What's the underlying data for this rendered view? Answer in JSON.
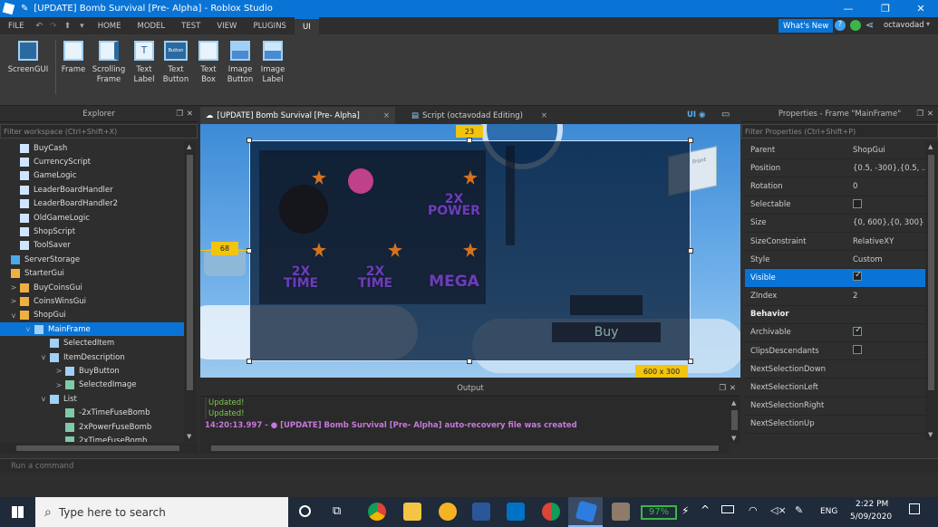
{
  "window": {
    "title": "[UPDATE] Bomb Survival [Pre- Alpha] - Roblox Studio",
    "whats_new": "What's New",
    "user": "octavodad"
  },
  "menu": [
    "FILE",
    "HOME",
    "MODEL",
    "TEST",
    "VIEW",
    "PLUGINS",
    "UI"
  ],
  "ribbon": [
    {
      "l1": "ScreenGUI",
      "l2": ""
    },
    {
      "l1": "Frame",
      "l2": ""
    },
    {
      "l1": "Scrolling",
      "l2": "Frame"
    },
    {
      "l1": "Text",
      "l2": "Label"
    },
    {
      "l1": "Text",
      "l2": "Button"
    },
    {
      "l1": "Text",
      "l2": "Box"
    },
    {
      "l1": "Image",
      "l2": "Button"
    },
    {
      "l1": "Image",
      "l2": "Label"
    }
  ],
  "ribbon_textbutton_glyph": "Button",
  "ribbon_text_glyph": "T",
  "explorer": {
    "title": "Explorer",
    "filter": "Filter workspace (Ctrl+Shift+X)",
    "items": [
      {
        "label": "BuyCash",
        "expander": ""
      },
      {
        "label": "CurrencyScript",
        "expander": ""
      },
      {
        "label": "GameLogic",
        "expander": ""
      },
      {
        "label": "LeaderBoardHandler",
        "expander": ""
      },
      {
        "label": "LeaderBoardHandler2",
        "expander": ""
      },
      {
        "label": "OldGameLogic",
        "expander": ""
      },
      {
        "label": "ShopScript",
        "expander": ""
      },
      {
        "label": "ToolSaver",
        "expander": ""
      },
      {
        "label": "ServerStorage",
        "expander": ""
      },
      {
        "label": "StarterGui",
        "expander": ""
      },
      {
        "label": "BuyCoinsGui",
        "expander": ">"
      },
      {
        "label": "CoinsWinsGui",
        "expander": ">"
      },
      {
        "label": "ShopGui",
        "expander": "v"
      },
      {
        "label": "MainFrame",
        "expander": "v"
      },
      {
        "label": "SelectedItem",
        "expander": ""
      },
      {
        "label": "ItemDescription",
        "expander": "v"
      },
      {
        "label": "BuyButton",
        "expander": ">"
      },
      {
        "label": "SelectedImage",
        "expander": ">"
      },
      {
        "label": "List",
        "expander": "v"
      },
      {
        "label": "-2xTimeFuseBomb",
        "expander": ""
      },
      {
        "label": "2xPowerFuseBomb",
        "expander": ""
      },
      {
        "label": "2xTimeFuseBomb",
        "expander": ""
      }
    ]
  },
  "tabs": [
    {
      "label": "[UPDATE] Bomb Survival [Pre- Alpha]",
      "close": "×"
    },
    {
      "label": "Script (octavodad Editing)",
      "close": "×"
    }
  ],
  "tab_ui_label": "UI",
  "viewport": {
    "top_offset": "23",
    "left_offset": "68",
    "size_label": "600 x 300",
    "cells": [
      "2X POWER",
      "2X TIME",
      "2X TIME",
      "MEGA"
    ],
    "buy": "Buy",
    "cube_label": "Front"
  },
  "output": {
    "title": "Output",
    "lines": [
      "Updated!",
      "Updated!"
    ],
    "timestamp": "14:20:13.997 -",
    "message": "[UPDATE] Bomb Survival [Pre- Alpha] auto-recovery file was created"
  },
  "properties": {
    "title": "Properties - Frame \"MainFrame\"",
    "filter": "Filter Properties (Ctrl+Shift+P)",
    "rows": [
      {
        "name": "Parent",
        "value": "ShopGui",
        "type": "text"
      },
      {
        "name": "Position",
        "value": "{0.5, -300},{0.5, ...",
        "type": "text"
      },
      {
        "name": "Rotation",
        "value": "0",
        "type": "text"
      },
      {
        "name": "Selectable",
        "value": "",
        "type": "check-off"
      },
      {
        "name": "Size",
        "value": "{0, 600},{0, 300}",
        "type": "text"
      },
      {
        "name": "SizeConstraint",
        "value": "RelativeXY",
        "type": "text"
      },
      {
        "name": "Style",
        "value": "Custom",
        "type": "text"
      },
      {
        "name": "Visible",
        "value": "",
        "type": "check-on"
      },
      {
        "name": "ZIndex",
        "value": "2",
        "type": "text"
      },
      {
        "name": "Behavior",
        "value": "",
        "type": "section"
      },
      {
        "name": "Archivable",
        "value": "",
        "type": "check-on"
      },
      {
        "name": "ClipsDescendants",
        "value": "",
        "type": "check-off"
      },
      {
        "name": "NextSelectionDown",
        "value": "",
        "type": "text"
      },
      {
        "name": "NextSelectionLeft",
        "value": "",
        "type": "text"
      },
      {
        "name": "NextSelectionRight",
        "value": "",
        "type": "text"
      },
      {
        "name": "NextSelectionUp",
        "value": "",
        "type": "text"
      }
    ]
  },
  "command": {
    "placeholder": "Run a command"
  },
  "taskbar": {
    "search": "Type here to search",
    "battery": "97%",
    "lang": "ENG",
    "time": "2:22 PM",
    "date": "5/09/2020"
  },
  "colors": {
    "accent": "#0a74d6",
    "highlight": "#f1c40f",
    "output_msg": "#c678dd",
    "output_ok": "#7ec850"
  }
}
